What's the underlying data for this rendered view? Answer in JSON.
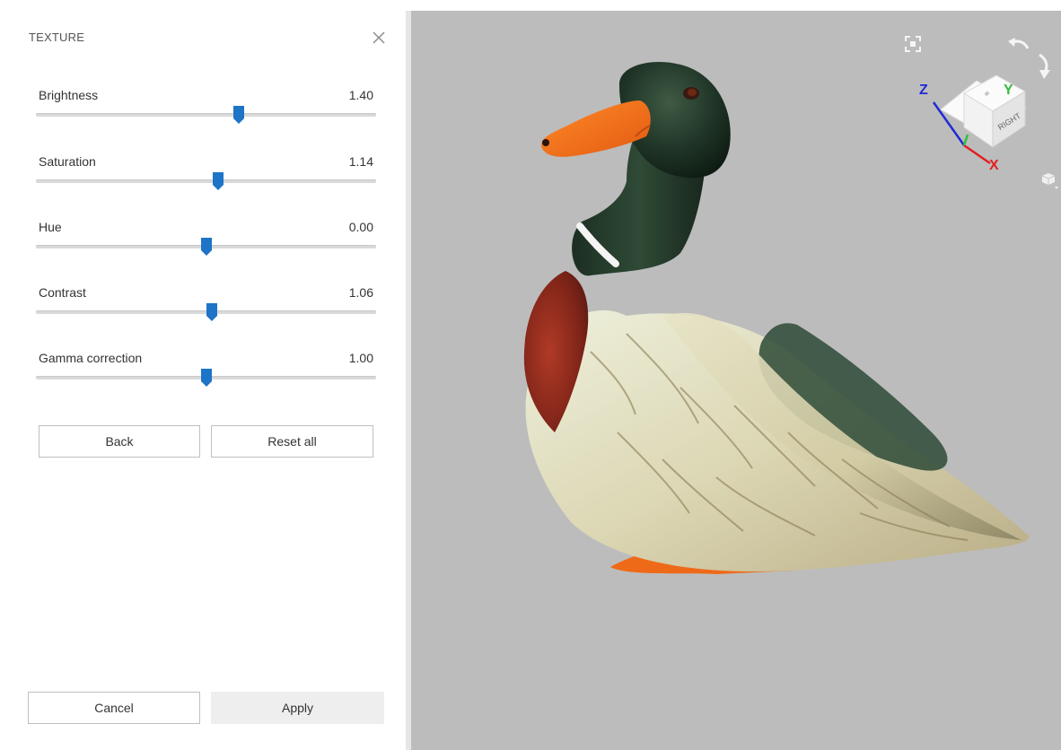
{
  "panel": {
    "title": "TEXTURE",
    "sliders": [
      {
        "label": "Brightness",
        "value": "1.40",
        "position": 0.597
      },
      {
        "label": "Saturation",
        "value": "1.14",
        "position": 0.536
      },
      {
        "label": "Hue",
        "value": "0.00",
        "position": 0.5
      },
      {
        "label": "Contrast",
        "value": "1.06",
        "position": 0.518
      },
      {
        "label": "Gamma correction",
        "value": "1.00",
        "position": 0.5
      }
    ],
    "back_label": "Back",
    "reset_label": "Reset all",
    "cancel_label": "Cancel",
    "apply_label": "Apply"
  },
  "viewport": {
    "gizmo": {
      "x_label": "X",
      "y_label": "Y",
      "z_label": "Z",
      "face_label": "RIGHT"
    },
    "icons": [
      "fit-view-icon",
      "rotate-left-icon",
      "rotate-down-icon",
      "view-mode-cube-icon"
    ]
  },
  "colors": {
    "accent": "#1e74c6",
    "viewport_bg": "#bcbcbc",
    "axis_x": "#e02020",
    "axis_y": "#2fbf3a",
    "axis_z": "#1f2bd6"
  }
}
